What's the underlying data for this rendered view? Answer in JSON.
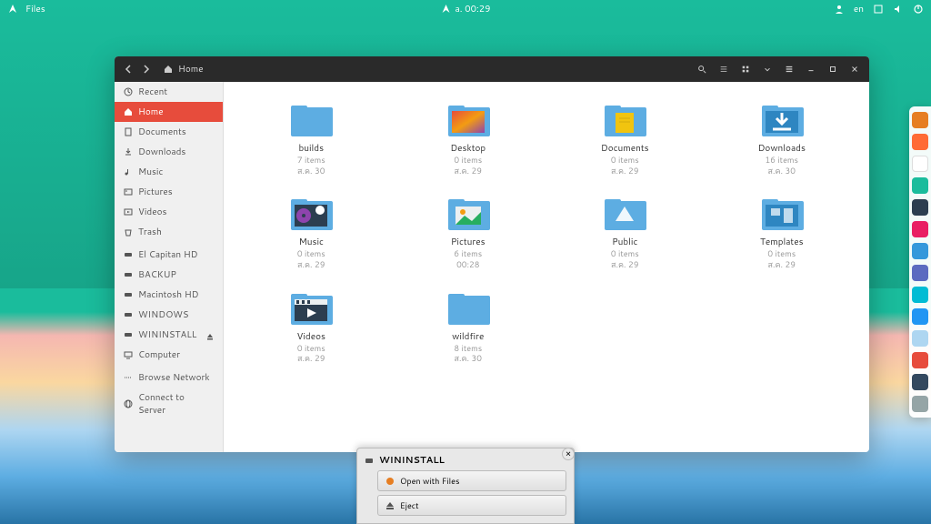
{
  "top_panel": {
    "app_label": "Files",
    "clock": "a. 00:29",
    "lang": "en"
  },
  "window": {
    "path": "Home"
  },
  "sidebar": [
    {
      "label": "Recent",
      "icon": "clock"
    },
    {
      "label": "Home",
      "icon": "home",
      "active": true
    },
    {
      "label": "Documents",
      "icon": "doc"
    },
    {
      "label": "Downloads",
      "icon": "download"
    },
    {
      "label": "Music",
      "icon": "music"
    },
    {
      "label": "Pictures",
      "icon": "picture"
    },
    {
      "label": "Videos",
      "icon": "video"
    },
    {
      "label": "Trash",
      "icon": "trash"
    },
    {
      "label": "El Capitan HD",
      "icon": "drive",
      "gap": true
    },
    {
      "label": "BACKUP",
      "icon": "drive"
    },
    {
      "label": "Macintosh HD",
      "icon": "drive"
    },
    {
      "label": "WINDOWS",
      "icon": "drive"
    },
    {
      "label": "WININSTALL",
      "icon": "drive",
      "eject": true
    },
    {
      "label": "Computer",
      "icon": "computer"
    },
    {
      "label": "Browse Network",
      "icon": "network",
      "gap": true
    },
    {
      "label": "Connect to Server",
      "icon": "server"
    }
  ],
  "folders": [
    {
      "name": "builds",
      "meta1": "7 items",
      "meta2": "ส.ค. 30",
      "variant": "plain"
    },
    {
      "name": "Desktop",
      "meta1": "0 items",
      "meta2": "ส.ค. 29",
      "variant": "desktop"
    },
    {
      "name": "Documents",
      "meta1": "0 items",
      "meta2": "ส.ค. 29",
      "variant": "documents"
    },
    {
      "name": "Downloads",
      "meta1": "16 items",
      "meta2": "ส.ค. 30",
      "variant": "downloads"
    },
    {
      "name": "Music",
      "meta1": "0 items",
      "meta2": "ส.ค. 29",
      "variant": "music"
    },
    {
      "name": "Pictures",
      "meta1": "6 items",
      "meta2": "00:28",
      "variant": "pictures"
    },
    {
      "name": "Public",
      "meta1": "0 items",
      "meta2": "ส.ค. 29",
      "variant": "public"
    },
    {
      "name": "Templates",
      "meta1": "0 items",
      "meta2": "ส.ค. 29",
      "variant": "templates"
    },
    {
      "name": "Videos",
      "meta1": "0 items",
      "meta2": "ส.ค. 29",
      "variant": "videos"
    },
    {
      "name": "wildfire",
      "meta1": "8 items",
      "meta2": "ส.ค. 30",
      "variant": "plain"
    }
  ],
  "notification": {
    "title": "WININSTALL",
    "open_label": "Open with Files",
    "eject_label": "Eject"
  },
  "dock": [
    {
      "color": "#e67e22"
    },
    {
      "color": "#ff6b35"
    },
    {
      "color": "#ffffff"
    },
    {
      "color": "#1abc9c"
    },
    {
      "color": "#2c3e50"
    },
    {
      "color": "#e91e63"
    },
    {
      "color": "#3498db"
    },
    {
      "color": "#5b6bc0"
    },
    {
      "color": "#00bcd4"
    },
    {
      "color": "#2196f3"
    },
    {
      "color": "#aed6f1"
    },
    {
      "color": "#e74c3c"
    },
    {
      "color": "#34495e"
    },
    {
      "color": "#95a5a6"
    }
  ]
}
